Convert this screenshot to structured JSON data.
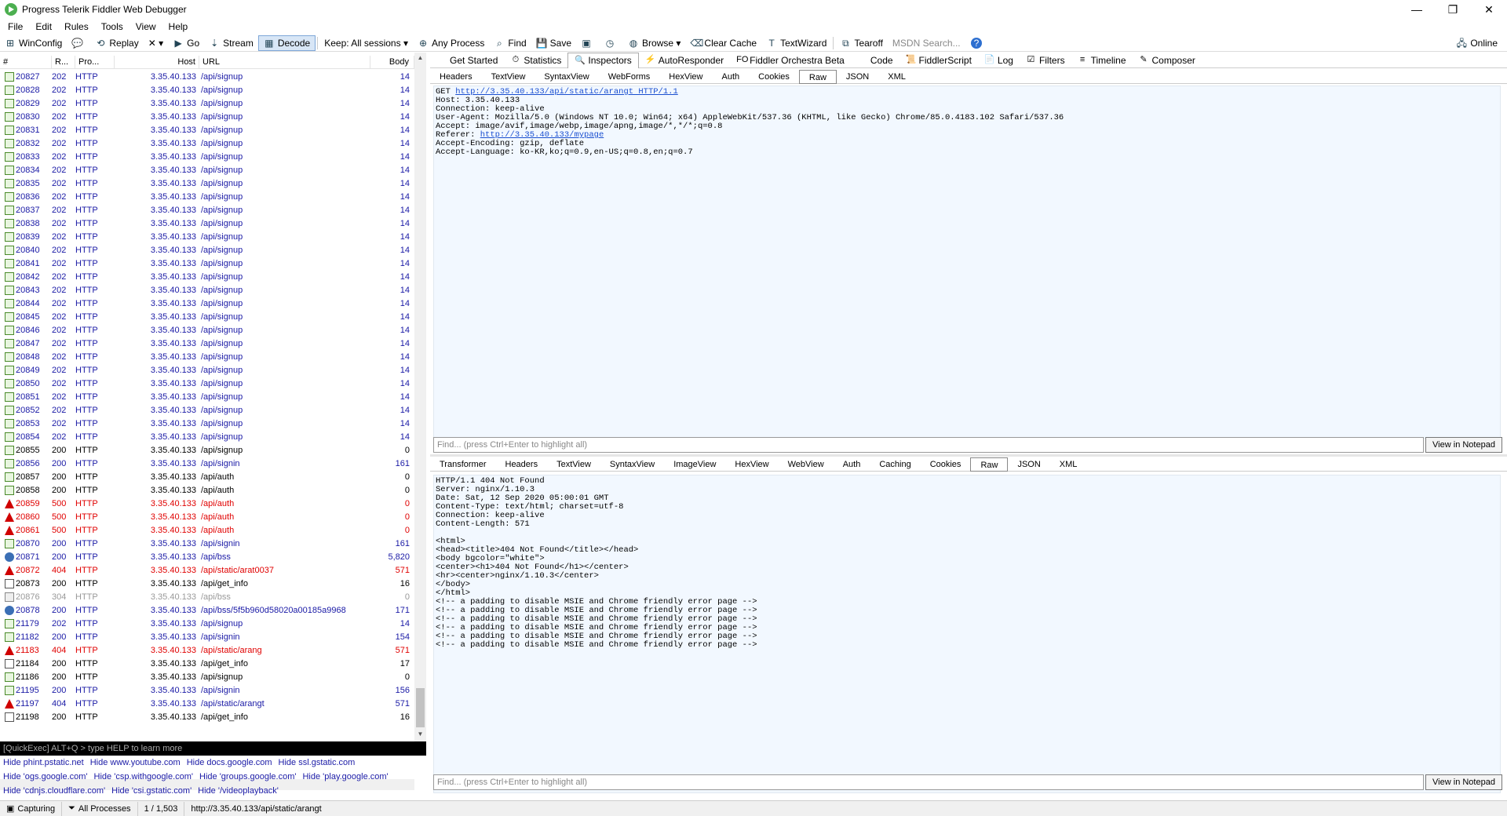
{
  "window": {
    "title": "Progress Telerik Fiddler Web Debugger",
    "minimize": "—",
    "maximize": "❐",
    "close": "✕"
  },
  "menu": [
    "File",
    "Edit",
    "Rules",
    "Tools",
    "View",
    "Help"
  ],
  "toolbar": {
    "winconfig": "WinConfig",
    "replay": "Replay",
    "remove": "✕ ▾",
    "go": "Go",
    "stream": "Stream",
    "decode": "Decode",
    "keep": "Keep: All sessions ▾",
    "any_process": "Any Process",
    "find": "Find",
    "save": "Save",
    "browse": "Browse ▾",
    "clear_cache": "Clear Cache",
    "textwizard": "TextWizard",
    "tearoff": "Tearoff",
    "msdn_search": "MSDN Search...",
    "online": "Online"
  },
  "session_columns": {
    "num": "#",
    "result": "R...",
    "protocol": "Pro...",
    "host": "Host",
    "url": "URL",
    "body": "Body"
  },
  "sessions": [
    {
      "num": "20827",
      "result": "202",
      "protocol": "HTTP",
      "host": "3.35.40.133",
      "url": "/api/signup",
      "body": "14",
      "kind": "post",
      "status": "blue"
    },
    {
      "num": "20828",
      "result": "202",
      "protocol": "HTTP",
      "host": "3.35.40.133",
      "url": "/api/signup",
      "body": "14",
      "kind": "post",
      "status": "blue"
    },
    {
      "num": "20829",
      "result": "202",
      "protocol": "HTTP",
      "host": "3.35.40.133",
      "url": "/api/signup",
      "body": "14",
      "kind": "post",
      "status": "blue"
    },
    {
      "num": "20830",
      "result": "202",
      "protocol": "HTTP",
      "host": "3.35.40.133",
      "url": "/api/signup",
      "body": "14",
      "kind": "post",
      "status": "blue"
    },
    {
      "num": "20831",
      "result": "202",
      "protocol": "HTTP",
      "host": "3.35.40.133",
      "url": "/api/signup",
      "body": "14",
      "kind": "post",
      "status": "blue"
    },
    {
      "num": "20832",
      "result": "202",
      "protocol": "HTTP",
      "host": "3.35.40.133",
      "url": "/api/signup",
      "body": "14",
      "kind": "post",
      "status": "blue"
    },
    {
      "num": "20833",
      "result": "202",
      "protocol": "HTTP",
      "host": "3.35.40.133",
      "url": "/api/signup",
      "body": "14",
      "kind": "post",
      "status": "blue"
    },
    {
      "num": "20834",
      "result": "202",
      "protocol": "HTTP",
      "host": "3.35.40.133",
      "url": "/api/signup",
      "body": "14",
      "kind": "post",
      "status": "blue"
    },
    {
      "num": "20835",
      "result": "202",
      "protocol": "HTTP",
      "host": "3.35.40.133",
      "url": "/api/signup",
      "body": "14",
      "kind": "post",
      "status": "blue"
    },
    {
      "num": "20836",
      "result": "202",
      "protocol": "HTTP",
      "host": "3.35.40.133",
      "url": "/api/signup",
      "body": "14",
      "kind": "post",
      "status": "blue"
    },
    {
      "num": "20837",
      "result": "202",
      "protocol": "HTTP",
      "host": "3.35.40.133",
      "url": "/api/signup",
      "body": "14",
      "kind": "post",
      "status": "blue"
    },
    {
      "num": "20838",
      "result": "202",
      "protocol": "HTTP",
      "host": "3.35.40.133",
      "url": "/api/signup",
      "body": "14",
      "kind": "post",
      "status": "blue"
    },
    {
      "num": "20839",
      "result": "202",
      "protocol": "HTTP",
      "host": "3.35.40.133",
      "url": "/api/signup",
      "body": "14",
      "kind": "post",
      "status": "blue"
    },
    {
      "num": "20840",
      "result": "202",
      "protocol": "HTTP",
      "host": "3.35.40.133",
      "url": "/api/signup",
      "body": "14",
      "kind": "post",
      "status": "blue"
    },
    {
      "num": "20841",
      "result": "202",
      "protocol": "HTTP",
      "host": "3.35.40.133",
      "url": "/api/signup",
      "body": "14",
      "kind": "post",
      "status": "blue"
    },
    {
      "num": "20842",
      "result": "202",
      "protocol": "HTTP",
      "host": "3.35.40.133",
      "url": "/api/signup",
      "body": "14",
      "kind": "post",
      "status": "blue"
    },
    {
      "num": "20843",
      "result": "202",
      "protocol": "HTTP",
      "host": "3.35.40.133",
      "url": "/api/signup",
      "body": "14",
      "kind": "post",
      "status": "blue"
    },
    {
      "num": "20844",
      "result": "202",
      "protocol": "HTTP",
      "host": "3.35.40.133",
      "url": "/api/signup",
      "body": "14",
      "kind": "post",
      "status": "blue"
    },
    {
      "num": "20845",
      "result": "202",
      "protocol": "HTTP",
      "host": "3.35.40.133",
      "url": "/api/signup",
      "body": "14",
      "kind": "post",
      "status": "blue"
    },
    {
      "num": "20846",
      "result": "202",
      "protocol": "HTTP",
      "host": "3.35.40.133",
      "url": "/api/signup",
      "body": "14",
      "kind": "post",
      "status": "blue"
    },
    {
      "num": "20847",
      "result": "202",
      "protocol": "HTTP",
      "host": "3.35.40.133",
      "url": "/api/signup",
      "body": "14",
      "kind": "post",
      "status": "blue"
    },
    {
      "num": "20848",
      "result": "202",
      "protocol": "HTTP",
      "host": "3.35.40.133",
      "url": "/api/signup",
      "body": "14",
      "kind": "post",
      "status": "blue"
    },
    {
      "num": "20849",
      "result": "202",
      "protocol": "HTTP",
      "host": "3.35.40.133",
      "url": "/api/signup",
      "body": "14",
      "kind": "post",
      "status": "blue"
    },
    {
      "num": "20850",
      "result": "202",
      "protocol": "HTTP",
      "host": "3.35.40.133",
      "url": "/api/signup",
      "body": "14",
      "kind": "post",
      "status": "blue"
    },
    {
      "num": "20851",
      "result": "202",
      "protocol": "HTTP",
      "host": "3.35.40.133",
      "url": "/api/signup",
      "body": "14",
      "kind": "post",
      "status": "blue"
    },
    {
      "num": "20852",
      "result": "202",
      "protocol": "HTTP",
      "host": "3.35.40.133",
      "url": "/api/signup",
      "body": "14",
      "kind": "post",
      "status": "blue"
    },
    {
      "num": "20853",
      "result": "202",
      "protocol": "HTTP",
      "host": "3.35.40.133",
      "url": "/api/signup",
      "body": "14",
      "kind": "post",
      "status": "blue"
    },
    {
      "num": "20854",
      "result": "202",
      "protocol": "HTTP",
      "host": "3.35.40.133",
      "url": "/api/signup",
      "body": "14",
      "kind": "post",
      "status": "blue"
    },
    {
      "num": "20855",
      "result": "200",
      "protocol": "HTTP",
      "host": "3.35.40.133",
      "url": "/api/signup",
      "body": "0",
      "kind": "post",
      "status": "ok200"
    },
    {
      "num": "20856",
      "result": "200",
      "protocol": "HTTP",
      "host": "3.35.40.133",
      "url": "/api/signin",
      "body": "161",
      "kind": "post",
      "status": "blue"
    },
    {
      "num": "20857",
      "result": "200",
      "protocol": "HTTP",
      "host": "3.35.40.133",
      "url": "/api/auth",
      "body": "0",
      "kind": "post",
      "status": "ok200"
    },
    {
      "num": "20858",
      "result": "200",
      "protocol": "HTTP",
      "host": "3.35.40.133",
      "url": "/api/auth",
      "body": "0",
      "kind": "post",
      "status": "ok200"
    },
    {
      "num": "20859",
      "result": "500",
      "protocol": "HTTP",
      "host": "3.35.40.133",
      "url": "/api/auth",
      "body": "0",
      "kind": "err",
      "status": "err"
    },
    {
      "num": "20860",
      "result": "500",
      "protocol": "HTTP",
      "host": "3.35.40.133",
      "url": "/api/auth",
      "body": "0",
      "kind": "err",
      "status": "err"
    },
    {
      "num": "20861",
      "result": "500",
      "protocol": "HTTP",
      "host": "3.35.40.133",
      "url": "/api/auth",
      "body": "0",
      "kind": "err",
      "status": "err"
    },
    {
      "num": "20870",
      "result": "200",
      "protocol": "HTTP",
      "host": "3.35.40.133",
      "url": "/api/signin",
      "body": "161",
      "kind": "post",
      "status": "blue"
    },
    {
      "num": "20871",
      "result": "200",
      "protocol": "HTTP",
      "host": "3.35.40.133",
      "url": "/api/bss",
      "body": "5,820",
      "kind": "ws",
      "status": "blue"
    },
    {
      "num": "20872",
      "result": "404",
      "protocol": "HTTP",
      "host": "3.35.40.133",
      "url": "/api/static/arat0037",
      "body": "571",
      "kind": "err",
      "status": "err"
    },
    {
      "num": "20873",
      "result": "200",
      "protocol": "HTTP",
      "host": "3.35.40.133",
      "url": "/api/get_info",
      "body": "16",
      "kind": "get",
      "status": "ok200"
    },
    {
      "num": "20876",
      "result": "304",
      "protocol": "HTTP",
      "host": "3.35.40.133",
      "url": "/api/bss",
      "body": "0",
      "kind": "gray",
      "status": "gray"
    },
    {
      "num": "20878",
      "result": "200",
      "protocol": "HTTP",
      "host": "3.35.40.133",
      "url": "/api/bss/5f5b960d58020a00185a9968",
      "body": "171",
      "kind": "ws",
      "status": "blue"
    },
    {
      "num": "21179",
      "result": "202",
      "protocol": "HTTP",
      "host": "3.35.40.133",
      "url": "/api/signup",
      "body": "14",
      "kind": "post",
      "status": "blue"
    },
    {
      "num": "21182",
      "result": "200",
      "protocol": "HTTP",
      "host": "3.35.40.133",
      "url": "/api/signin",
      "body": "154",
      "kind": "post",
      "status": "blue"
    },
    {
      "num": "21183",
      "result": "404",
      "protocol": "HTTP",
      "host": "3.35.40.133",
      "url": "/api/static/arang",
      "body": "571",
      "kind": "err",
      "status": "err"
    },
    {
      "num": "21184",
      "result": "200",
      "protocol": "HTTP",
      "host": "3.35.40.133",
      "url": "/api/get_info",
      "body": "17",
      "kind": "get",
      "status": "ok200"
    },
    {
      "num": "21186",
      "result": "200",
      "protocol": "HTTP",
      "host": "3.35.40.133",
      "url": "/api/signup",
      "body": "0",
      "kind": "post",
      "status": "ok200"
    },
    {
      "num": "21195",
      "result": "200",
      "protocol": "HTTP",
      "host": "3.35.40.133",
      "url": "/api/signin",
      "body": "156",
      "kind": "post",
      "status": "blue"
    },
    {
      "num": "21197",
      "result": "404",
      "protocol": "HTTP",
      "host": "3.35.40.133",
      "url": "/api/static/arangt",
      "body": "571",
      "kind": "err",
      "status": "selected"
    },
    {
      "num": "21198",
      "result": "200",
      "protocol": "HTTP",
      "host": "3.35.40.133",
      "url": "/api/get_info",
      "body": "16",
      "kind": "get",
      "status": "ok200"
    }
  ],
  "quickexec": {
    "placeholder": "[QuickExec] ALT+Q > type HELP to learn more"
  },
  "hide_rules": [
    [
      "Hide phint.pstatic.net",
      "Hide www.youtube.com",
      "Hide docs.google.com",
      "Hide ssl.gstatic.com"
    ],
    [
      "Hide 'ogs.google.com'",
      "Hide 'csp.withgoogle.com'",
      "Hide 'groups.google.com'",
      "Hide 'play.google.com'"
    ],
    [
      "Hide 'cdnjs.cloudflare.com'",
      "Hide 'csi.gstatic.com'",
      "Hide '/videoplayback'"
    ]
  ],
  "main_tabs": [
    "Get Started",
    "Statistics",
    "Inspectors",
    "AutoResponder",
    "Fiddler Orchestra Beta",
    "Code",
    "FiddlerScript",
    "Log",
    "Filters",
    "Timeline",
    "Composer"
  ],
  "main_tab_icons": [
    "",
    "⏱",
    "🔍",
    "⚡",
    "FO",
    "",
    "📜",
    "📄",
    "☑",
    "≡",
    "✎"
  ],
  "request_tabs": [
    "Headers",
    "TextView",
    "SyntaxView",
    "WebForms",
    "HexView",
    "Auth",
    "Cookies",
    "Raw",
    "JSON",
    "XML"
  ],
  "response_tabs": [
    "Transformer",
    "Headers",
    "TextView",
    "SyntaxView",
    "ImageView",
    "HexView",
    "WebView",
    "Auth",
    "Caching",
    "Cookies",
    "Raw",
    "JSON",
    "XML"
  ],
  "request_raw": {
    "method": "GET ",
    "url": "http://3.35.40.133/api/static/arangt HTTP/1.1",
    "lines_a": [
      "Host: 3.35.40.133",
      "Connection: keep-alive",
      "User-Agent: Mozilla/5.0 (Windows NT 10.0; Win64; x64) AppleWebKit/537.36 (KHTML, like Gecko) Chrome/85.0.4183.102 Safari/537.36",
      "Accept: image/avif,image/webp,image/apng,image/*,*/*;q=0.8"
    ],
    "referer_label": "Referer: ",
    "referer_url": "http://3.35.40.133/mypage",
    "lines_b": [
      "Accept-Encoding: gzip, deflate",
      "Accept-Language: ko-KR,ko;q=0.9,en-US;q=0.8,en;q=0.7"
    ]
  },
  "response_raw": "HTTP/1.1 404 Not Found\nServer: nginx/1.10.3\nDate: Sat, 12 Sep 2020 05:00:01 GMT\nContent-Type: text/html; charset=utf-8\nConnection: keep-alive\nContent-Length: 571\n\n<html>\n<head><title>404 Not Found</title></head>\n<body bgcolor=\"white\">\n<center><h1>404 Not Found</h1></center>\n<hr><center>nginx/1.10.3</center>\n</body>\n</html>\n<!-- a padding to disable MSIE and Chrome friendly error page -->\n<!-- a padding to disable MSIE and Chrome friendly error page -->\n<!-- a padding to disable MSIE and Chrome friendly error page -->\n<!-- a padding to disable MSIE and Chrome friendly error page -->\n<!-- a padding to disable MSIE and Chrome friendly error page -->\n<!-- a padding to disable MSIE and Chrome friendly error page -->",
  "find_bar": {
    "placeholder": "Find... (press Ctrl+Enter to highlight all)",
    "notepad": "View in Notepad"
  },
  "status": {
    "capturing": "Capturing",
    "processes": "All Processes",
    "count": "1 / 1,503",
    "url": "http://3.35.40.133/api/static/arangt"
  },
  "colors": {
    "selected": "#0a64c8",
    "error": "#e00000",
    "link": "#1a1aa6"
  }
}
